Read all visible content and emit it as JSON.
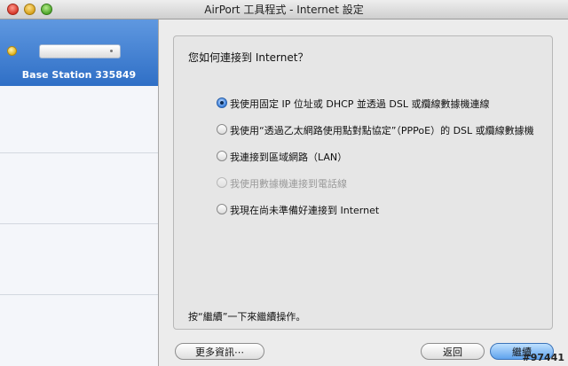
{
  "window": {
    "title": "AirPort 工具程式 - Internet 設定"
  },
  "sidebar": {
    "device_name": "Base Station 335849",
    "status_color": "#e2b51d"
  },
  "main": {
    "question": "您如何連接到 Internet？",
    "options": [
      {
        "label": "我使用固定 IP 位址或 DHCP 並透過 DSL 或纜線數據機連線",
        "selected": true,
        "disabled": false
      },
      {
        "label": "我使用“透過乙太網路使用點對點協定”（PPPoE）的 DSL 或纜線數據機",
        "selected": false,
        "disabled": false
      },
      {
        "label": "我連接到區域網路（LAN）",
        "selected": false,
        "disabled": false
      },
      {
        "label": "我使用數據機連接到電話線",
        "selected": false,
        "disabled": true
      },
      {
        "label": "我現在尚未準備好連接到 Internet",
        "selected": false,
        "disabled": false
      }
    ],
    "hint": "按“繼續”一下來繼續操作。"
  },
  "buttons": {
    "more_info": "更多資訊⋯",
    "back": "返回",
    "continue": "繼續"
  },
  "watermark": "#97441"
}
